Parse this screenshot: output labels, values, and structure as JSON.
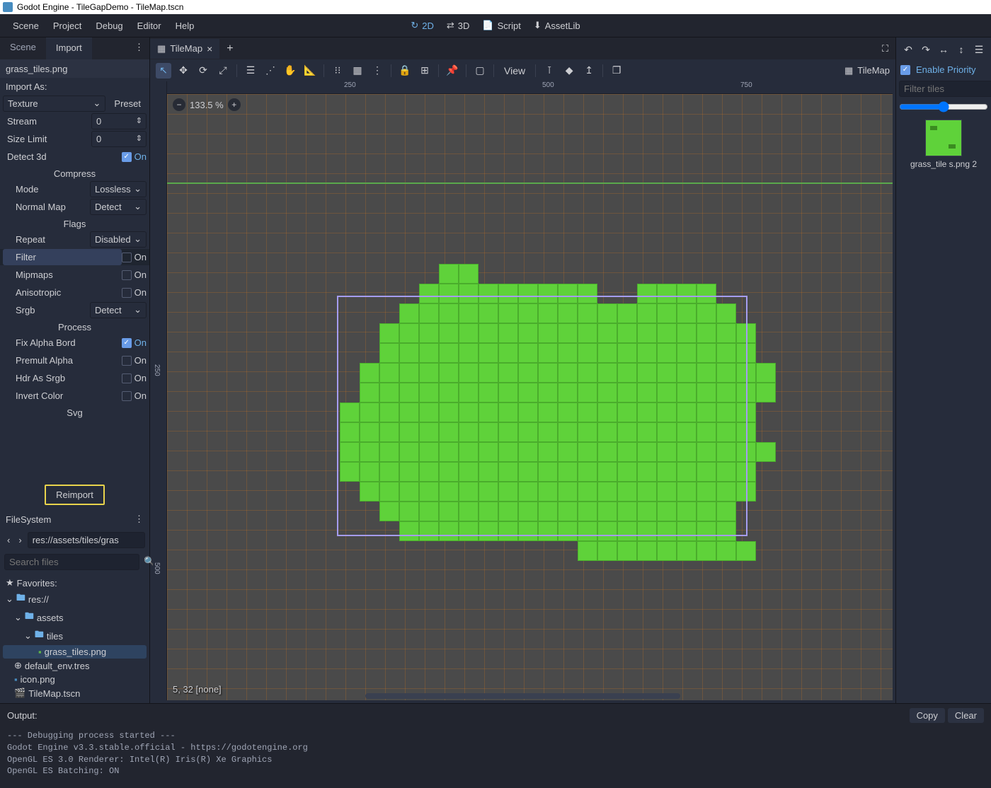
{
  "titlebar": "Godot Engine - TileGapDemo - TileMap.tscn",
  "menubar": [
    "Scene",
    "Project",
    "Debug",
    "Editor",
    "Help"
  ],
  "workspaces": {
    "d2": "2D",
    "d3": "3D",
    "script": "Script",
    "asset": "AssetLib"
  },
  "left_tabs": {
    "scene": "Scene",
    "import": "Import"
  },
  "import": {
    "file": "grass_tiles.png",
    "as": "Import As:",
    "type": "Texture",
    "preset": "Preset",
    "stream": "Stream",
    "stream_val": "0",
    "size_limit": "Size Limit",
    "size_limit_val": "0",
    "detect3d": "Detect 3d",
    "compress_hdr": "Compress",
    "mode": "Mode",
    "mode_val": "Lossless",
    "nmap": "Normal Map",
    "nmap_val": "Detect",
    "flags_hdr": "Flags",
    "repeat": "Repeat",
    "repeat_val": "Disabled",
    "filter": "Filter",
    "mipmaps": "Mipmaps",
    "aniso": "Anisotropic",
    "srgb": "Srgb",
    "srgb_val": "Detect",
    "process_hdr": "Process",
    "fix_alpha": "Fix Alpha Bord",
    "premult": "Premult Alpha",
    "hdr_srgb": "Hdr As Srgb",
    "invert": "Invert Color",
    "svg_hdr": "Svg",
    "on": "On",
    "reimport": "Reimport"
  },
  "filesystem": {
    "title": "FileSystem",
    "path": "res://assets/tiles/gras",
    "search": "Search files",
    "fav": "Favorites:",
    "root": "res://",
    "assets": "assets",
    "tiles": "tiles",
    "grass": "grass_tiles.png",
    "env": "default_env.tres",
    "icon": "icon.png",
    "tmap": "TileMap.tscn"
  },
  "scene_tab": "TileMap",
  "toolbar": {
    "view": "View"
  },
  "ruler": {
    "t250": "250",
    "t500": "500",
    "t750": "750",
    "l250": "250",
    "l500": "500"
  },
  "zoom": "133.5 %",
  "coords": "5, 32 [none]",
  "right": {
    "title": "TileMap",
    "enable": "Enable Priority",
    "filter": "Filter tiles",
    "thumb": "grass_tile\ns.png 2"
  },
  "output": {
    "title": "Output:",
    "copy": "Copy",
    "clear": "Clear",
    "text": "--- Debugging process started ---\nGodot Engine v3.3.stable.official - https://godotengine.org\nOpenGL ES 3.0 Renderer: Intel(R) Iris(R) Xe Graphics\nOpenGL ES Batching: ON"
  },
  "tilemap_pattern": [
    "0000000011000000000000000",
    "0000000111111111001111000",
    "0000001111111111111111100",
    "0000011111111111111111110",
    "0000011111111111111111110",
    "0000111111111111111111111",
    "0000111111111111111111111",
    "0001111111111111111111110",
    "0001111111111111111111110",
    "0001111111111111111111111",
    "0001111111111111111111110",
    "0000111111111111111111110",
    "0000011111111111111111100",
    "0000001111111111111111100",
    "0000000000000001111111110"
  ]
}
